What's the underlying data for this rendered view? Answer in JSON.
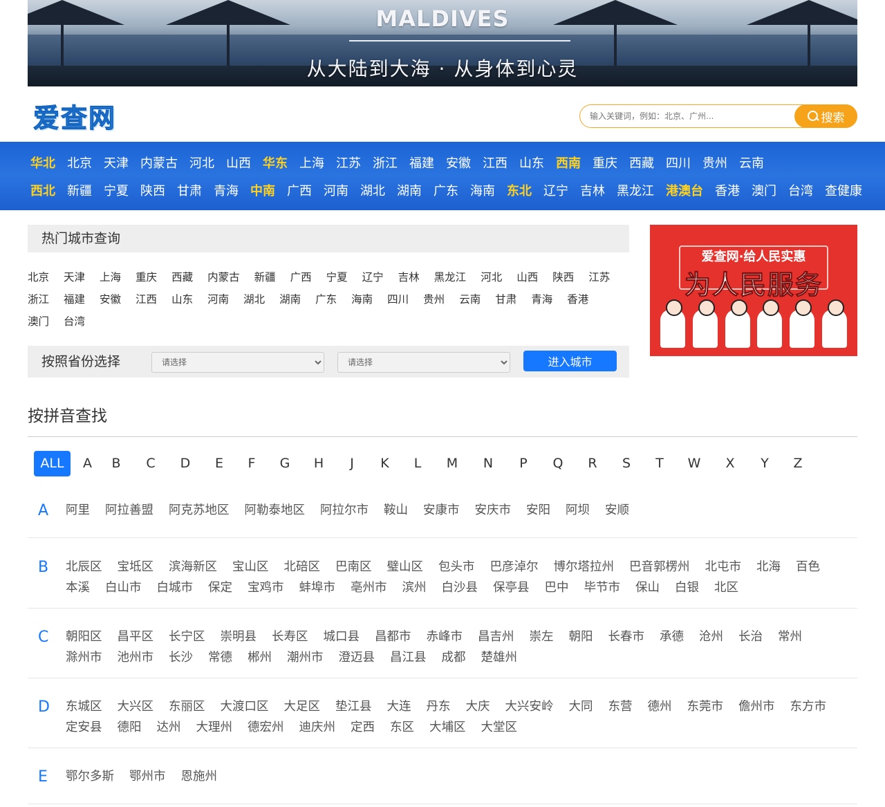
{
  "banner": {
    "title": "MALDIVES",
    "subtitle": "从大陆到大海 · 从身体到心灵"
  },
  "header": {
    "logo_text": "爱查网",
    "search_placeholder": "输入关键词，例如：北京、广州...",
    "search_button": "搜索"
  },
  "region_nav": {
    "row1": [
      {
        "label": "华北",
        "region": true
      },
      {
        "label": "北京"
      },
      {
        "label": "天津"
      },
      {
        "label": "内蒙古"
      },
      {
        "label": "河北"
      },
      {
        "label": "山西"
      },
      {
        "label": "华东",
        "region": true
      },
      {
        "label": "上海"
      },
      {
        "label": "江苏"
      },
      {
        "label": "浙江"
      },
      {
        "label": "福建"
      },
      {
        "label": "安徽"
      },
      {
        "label": "江西"
      },
      {
        "label": "山东"
      },
      {
        "label": "西南",
        "region": true
      },
      {
        "label": "重庆"
      },
      {
        "label": "西藏"
      },
      {
        "label": "四川"
      },
      {
        "label": "贵州"
      },
      {
        "label": "云南"
      }
    ],
    "row2": [
      {
        "label": "西北",
        "region": true
      },
      {
        "label": "新疆"
      },
      {
        "label": "宁夏"
      },
      {
        "label": "陕西"
      },
      {
        "label": "甘肃"
      },
      {
        "label": "青海"
      },
      {
        "label": "中南",
        "region": true
      },
      {
        "label": "广西"
      },
      {
        "label": "河南"
      },
      {
        "label": "湖北"
      },
      {
        "label": "湖南"
      },
      {
        "label": "广东"
      },
      {
        "label": "海南"
      },
      {
        "label": "东北",
        "region": true
      },
      {
        "label": "辽宁"
      },
      {
        "label": "吉林"
      },
      {
        "label": "黑龙江"
      },
      {
        "label": "港澳台",
        "region": true
      },
      {
        "label": "香港"
      },
      {
        "label": "澳门"
      },
      {
        "label": "台湾"
      },
      {
        "label": "查健康"
      }
    ]
  },
  "hot_cities": {
    "title": "热门城市查询",
    "items": [
      "北京",
      "天津",
      "上海",
      "重庆",
      "西藏",
      "内蒙古",
      "新疆",
      "广西",
      "宁夏",
      "辽宁",
      "吉林",
      "黑龙江",
      "河北",
      "山西",
      "陕西",
      "江苏",
      "浙江",
      "福建",
      "安徽",
      "江西",
      "山东",
      "河南",
      "湖北",
      "湖南",
      "广东",
      "海南",
      "四川",
      "贵州",
      "云南",
      "甘肃",
      "青海",
      "香港",
      "澳门",
      "台湾"
    ]
  },
  "ad": {
    "line1": "爱查网·给人民实惠",
    "line2": "为人民服务"
  },
  "province_select": {
    "label": "按照省份选择",
    "select1": "请选择",
    "select2": "请选择",
    "button": "进入城市"
  },
  "pinyin": {
    "title": "按拼音查找",
    "letters": [
      "ALL",
      "A",
      "B",
      "C",
      "D",
      "E",
      "F",
      "G",
      "H",
      "J",
      "K",
      "L",
      "M",
      "N",
      "P",
      "Q",
      "R",
      "S",
      "T",
      "W",
      "X",
      "Y",
      "Z"
    ],
    "active": "ALL",
    "groups": [
      {
        "letter": "A",
        "cities": [
          "阿里",
          "阿拉善盟",
          "阿克苏地区",
          "阿勒泰地区",
          "阿拉尔市",
          "鞍山",
          "安康市",
          "安庆市",
          "安阳",
          "阿坝",
          "安顺"
        ]
      },
      {
        "letter": "B",
        "cities": [
          "北辰区",
          "宝坻区",
          "滨海新区",
          "宝山区",
          "北碚区",
          "巴南区",
          "璧山区",
          "包头市",
          "巴彦淖尔",
          "博尔塔拉州",
          "巴音郭楞州",
          "北屯市",
          "北海",
          "百色",
          "本溪",
          "白山市",
          "白城市",
          "保定",
          "宝鸡市",
          "蚌埠市",
          "亳州市",
          "滨州",
          "白沙县",
          "保亭县",
          "巴中",
          "毕节市",
          "保山",
          "白银",
          "北区"
        ]
      },
      {
        "letter": "C",
        "cities": [
          "朝阳区",
          "昌平区",
          "长宁区",
          "崇明县",
          "长寿区",
          "城口县",
          "昌都市",
          "赤峰市",
          "昌吉州",
          "崇左",
          "朝阳",
          "长春市",
          "承德",
          "沧州",
          "长治",
          "常州",
          "滁州市",
          "池州市",
          "长沙",
          "常德",
          "郴州",
          "潮州市",
          "澄迈县",
          "昌江县",
          "成都",
          "楚雄州"
        ]
      },
      {
        "letter": "D",
        "cities": [
          "东城区",
          "大兴区",
          "东丽区",
          "大渡口区",
          "大足区",
          "垫江县",
          "大连",
          "丹东",
          "大庆",
          "大兴安岭",
          "大同",
          "东营",
          "德州",
          "东莞市",
          "儋州市",
          "东方市",
          "定安县",
          "德阳",
          "达州",
          "大理州",
          "德宏州",
          "迪庆州",
          "定西",
          "东区",
          "大埔区",
          "大堂区"
        ]
      },
      {
        "letter": "E",
        "cities": [
          "鄂尔多斯",
          "鄂州市",
          "恩施州"
        ]
      }
    ]
  }
}
